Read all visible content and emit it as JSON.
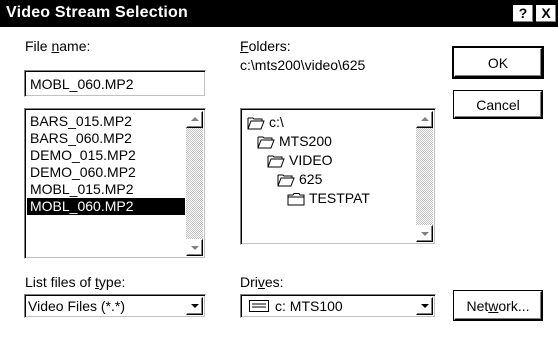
{
  "window": {
    "title": "Video Stream Selection",
    "help_button": "?",
    "close_button": "X"
  },
  "file_name": {
    "label_pre": "File ",
    "label_ul": "n",
    "label_post": "ame:",
    "value": "MOBL_060.MP2"
  },
  "file_list": {
    "items": [
      "BARS_015.MP2",
      "BARS_060.MP2",
      "DEMO_015.MP2",
      "DEMO_060.MP2",
      "MOBL_015.MP2",
      "MOBL_060.MP2"
    ],
    "selected_index": 5
  },
  "folders": {
    "label_ul": "F",
    "label_post": "olders:",
    "current_path": "c:\\mts200\\video\\625",
    "tree": [
      {
        "name": "c:\\",
        "icon": "open-folder-icon"
      },
      {
        "name": "MTS200",
        "icon": "open-folder-icon"
      },
      {
        "name": "VIDEO",
        "icon": "open-folder-icon"
      },
      {
        "name": "625",
        "icon": "open-folder-icon"
      },
      {
        "name": "TESTPAT",
        "icon": "closed-folder-icon"
      }
    ]
  },
  "file_type": {
    "label_pre": "List files of ",
    "label_ul": "t",
    "label_post": "ype:",
    "selected": "Video Files (*.*)"
  },
  "drives": {
    "label_pre": "Dri",
    "label_ul": "v",
    "label_post": "es:",
    "selected": "c: MTS100",
    "icon": "drive-icon"
  },
  "buttons": {
    "ok": "OK",
    "cancel": "Cancel",
    "network_pre": "Net",
    "network_ul": "w",
    "network_post": "ork..."
  }
}
